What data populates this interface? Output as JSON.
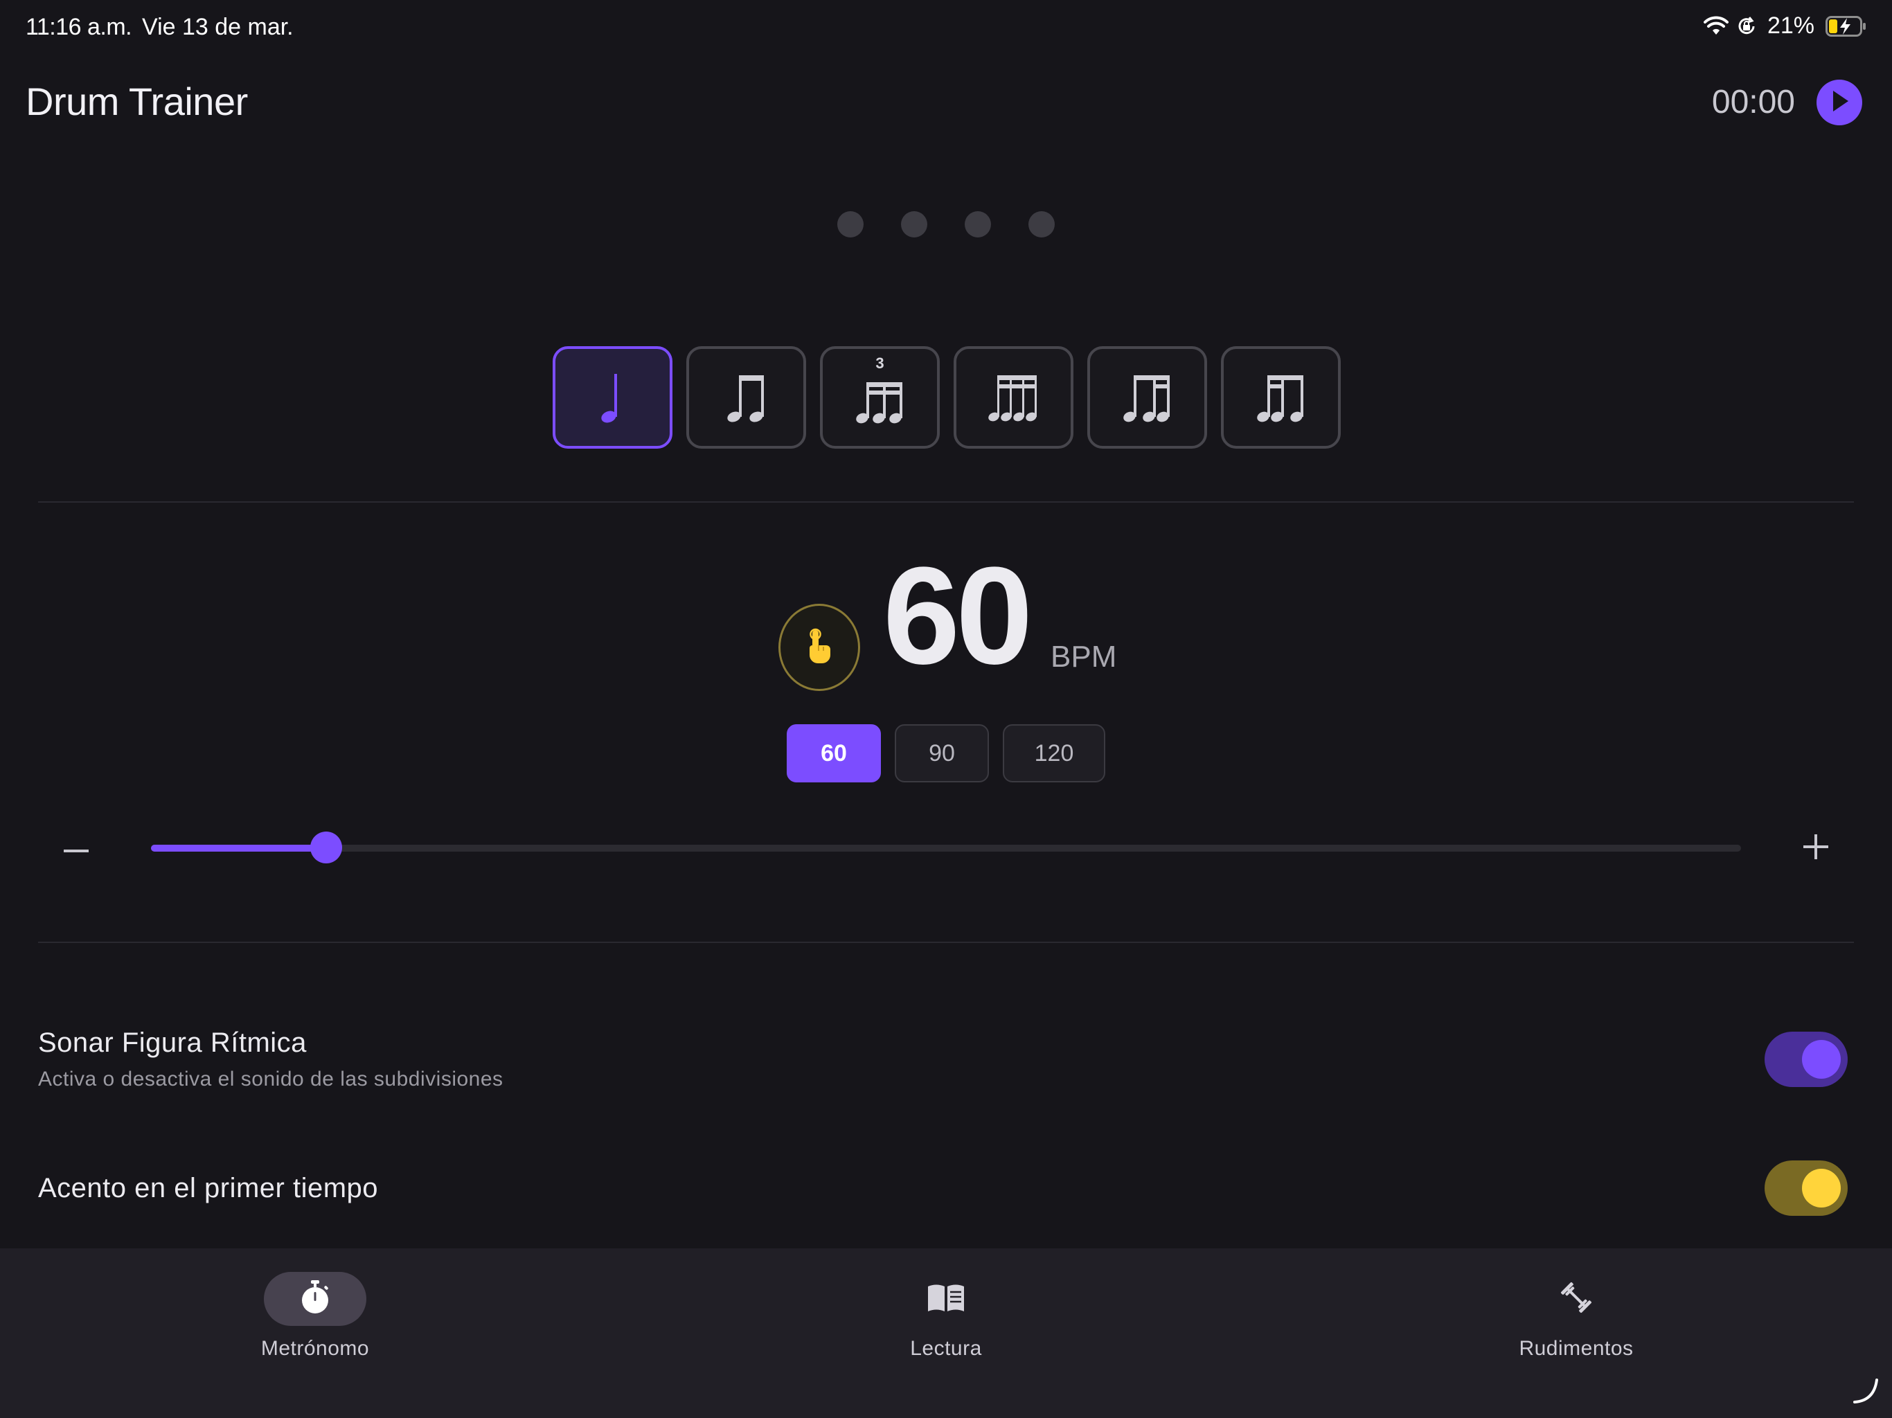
{
  "status_bar": {
    "time": "11:16 a.m.",
    "date": "Vie 13 de mar.",
    "battery": "21%",
    "icons": [
      "wifi-icon",
      "orientation-lock-icon",
      "battery-charging-icon"
    ]
  },
  "header": {
    "title": "Drum Trainer",
    "timer": "00:00",
    "play_icon": "play-icon"
  },
  "beats": {
    "count": 4
  },
  "figures": {
    "selected": 0,
    "items": [
      {
        "name": "quarter-note",
        "tuplet": ""
      },
      {
        "name": "eighth-notes",
        "tuplet": ""
      },
      {
        "name": "triplet",
        "tuplet": "3"
      },
      {
        "name": "sixteenth-notes",
        "tuplet": ""
      },
      {
        "name": "eighth-two-sixteenths",
        "tuplet": ""
      },
      {
        "name": "two-sixteenths-eighth",
        "tuplet": ""
      }
    ]
  },
  "tempo": {
    "bpm": "60",
    "unit": "BPM",
    "tap_icon": "tap-finger-icon",
    "presets": [
      "60",
      "90",
      "120"
    ],
    "selected_preset": 0,
    "slider_fraction": 0.11
  },
  "settings": [
    {
      "title": "Sonar Figura Rítmica",
      "subtitle": "Activa o desactiva el sonido de las subdivisiones",
      "on": true,
      "color": "#7c4dff"
    },
    {
      "title": "Acento en el primer tiempo",
      "subtitle": "",
      "on": true,
      "color": "#ffd43b"
    }
  ],
  "tabs": [
    {
      "label": "Metrónomo",
      "icon": "stopwatch-icon",
      "active": true
    },
    {
      "label": "Lectura",
      "icon": "book-icon",
      "active": false
    },
    {
      "label": "Rudimentos",
      "icon": "dumbbell-icon",
      "active": false
    }
  ],
  "colors": {
    "accent": "#7c4dff",
    "accent_secondary": "#ffd43b",
    "background": "#16151a"
  }
}
